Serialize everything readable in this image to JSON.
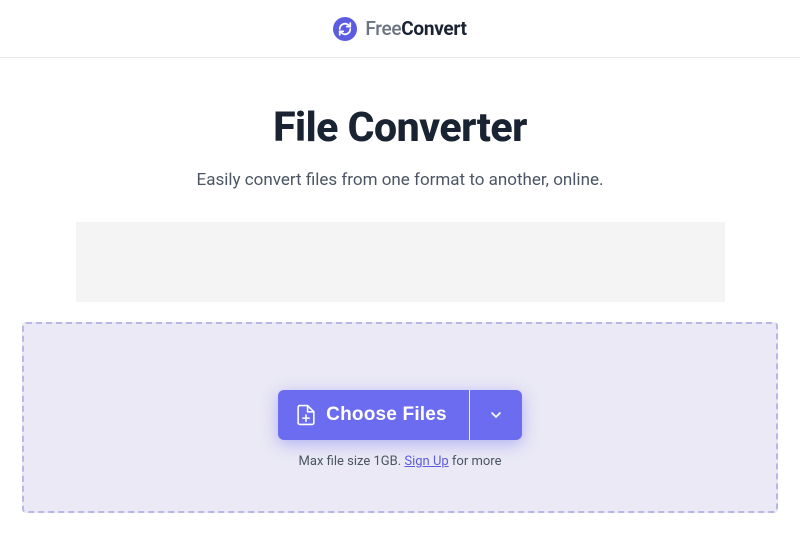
{
  "header": {
    "brand_light": "Free",
    "brand_bold": "Convert"
  },
  "main": {
    "title": "File Converter",
    "subtitle": "Easily convert files from one format to another, online."
  },
  "dropzone": {
    "choose_label": "Choose Files",
    "hint_prefix": "Max file size 1GB. ",
    "signup_label": "Sign Up",
    "hint_suffix": " for more"
  }
}
